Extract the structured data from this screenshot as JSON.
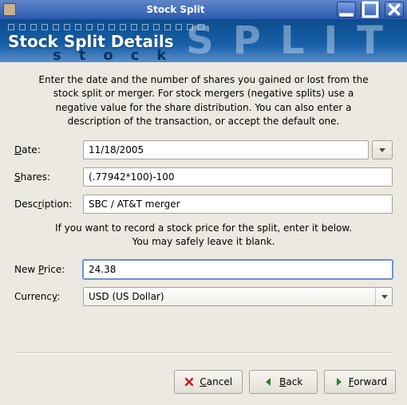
{
  "window": {
    "title": "Stock Split"
  },
  "banner": {
    "heading": "Stock Split Details",
    "big": "SPLIT",
    "small": "stock"
  },
  "intro": "Enter the date and the number of shares you gained or lost from the stock split or merger. For stock mergers (negative splits) use a negative value for the share distribution. You can also enter a description of the transaction, or accept the default one.",
  "labels": {
    "date_pre": "",
    "date_u": "D",
    "date_post": "ate:",
    "shares_pre": "",
    "shares_u": "S",
    "shares_post": "hares:",
    "desc_pre": "Desc",
    "desc_u": "r",
    "desc_post": "iption:",
    "newprice_pre": "New ",
    "newprice_u": "P",
    "newprice_post": "rice:",
    "currency_pre": "Currenc",
    "currency_u": "y",
    "currency_post": ":"
  },
  "fields": {
    "date": "11/18/2005",
    "shares": "(.77942*100)-100",
    "description": "SBC / AT&T merger",
    "new_price": "24.38",
    "currency": "USD (US Dollar)"
  },
  "mid": "If you want to record a stock price for the split, enter it below. You may safely leave it blank.",
  "buttons": {
    "cancel_pre": "",
    "cancel_u": "C",
    "cancel_post": "ancel",
    "back_pre": "",
    "back_u": "B",
    "back_post": "ack",
    "forward_pre": "",
    "forward_u": "F",
    "forward_post": "orward"
  },
  "colors": {
    "titlebar": "#2b5ab0",
    "banner": "#1760a8",
    "body": "#ece9e2"
  }
}
